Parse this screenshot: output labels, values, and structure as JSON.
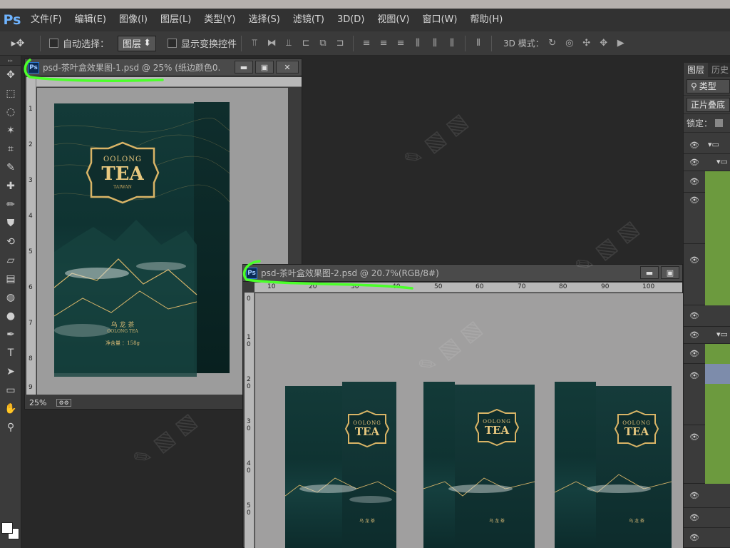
{
  "app": {
    "logo": "Ps"
  },
  "menu": [
    "文件(F)",
    "编辑(E)",
    "图像(I)",
    "图层(L)",
    "类型(Y)",
    "选择(S)",
    "滤镜(T)",
    "3D(D)",
    "视图(V)",
    "窗口(W)",
    "帮助(H)"
  ],
  "options": {
    "tool_glyph": "▸✥",
    "auto_select_label": "自动选择：",
    "auto_select_value": "图层",
    "show_transform_label": "显示变换控件",
    "mode_label": "3D 模式："
  },
  "doc1": {
    "badge": "Ps",
    "title": "psd-茶叶盒效果图-1.psd @ 25% (纸边颜色0...",
    "zoom": "25%",
    "ruler_v_labels": [
      "1",
      "2",
      "3",
      "4",
      "5",
      "6",
      "7",
      "8",
      "9"
    ]
  },
  "doc2": {
    "badge": "Ps",
    "title": "psd-茶叶盒效果图-2.psd @ 20.7%(RGB/8#)",
    "ruler_h_labels": [
      "10",
      "20",
      "30",
      "40",
      "50",
      "60",
      "70",
      "80",
      "90",
      "100"
    ],
    "ruler_v_labels": [
      "0",
      "1 0",
      "2 0",
      "3 0",
      "4 0",
      "5 0"
    ]
  },
  "window_buttons": {
    "minimize": "▬",
    "restore": "▣",
    "close": "✕"
  },
  "tea_box": {
    "emblem_top": "OOLONG",
    "emblem_main": "TEA",
    "emblem_bottom": "TAIWAN",
    "chinese_name": "乌 龙 茶",
    "english_name": "OOLONG TEA",
    "net_weight": "净含量 ：158g"
  },
  "right_panel": {
    "tab_layers": "图层",
    "tab_history": "历史",
    "filter_kind": "类型",
    "blend_mode": "正片叠底",
    "lock_label": "锁定："
  },
  "colors": {
    "accent_green": "#4bff2a",
    "layer_green": "#6c9a3e",
    "tea_teal": "#123836",
    "gold": "#e2c078"
  }
}
